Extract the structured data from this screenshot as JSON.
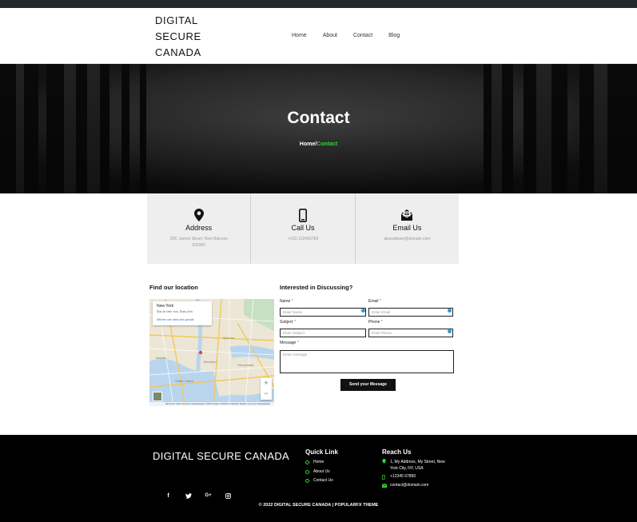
{
  "header": {
    "logo_line1": "DIGITAL",
    "logo_line2": "SECURE",
    "logo_line3": "CANADA",
    "nav": [
      "Home",
      "About",
      "Contact",
      "Blog"
    ]
  },
  "hero": {
    "title": "Contact",
    "breadcrumb_home": "Home/",
    "breadcrumb_current": "Contact"
  },
  "info": [
    {
      "title": "Address",
      "text": "208, James Street, New Balcony 502360",
      "icon": "map-pin-icon"
    },
    {
      "title": "Call Us",
      "text": "+(23) 123456789",
      "icon": "phone-icon"
    },
    {
      "title": "Email Us",
      "text": "abcpaiteam@domain.com",
      "icon": "envelope-icon"
    }
  ],
  "map": {
    "heading": "Find our location",
    "card_title": "New York",
    "card_sub": "État de New York, États-Unis",
    "card_link": "Afficher une carte plus grande",
    "zoom_in": "+",
    "zoom_out": "−",
    "footer": "Raccourcis clavier   Données cartographiques ©2022 Google   Conditions d'utilisation   Signaler une erreur cartographique"
  },
  "form": {
    "heading": "Interested in Discussing?",
    "name_label": "Name",
    "name_placeholder": "Enter Name",
    "email_label": "Email",
    "email_placeholder": "Enter Email",
    "subject_label": "Subject",
    "subject_placeholder": "Enter Subject",
    "phone_label": "Phone",
    "phone_placeholder": "Enter Phone",
    "message_label": "Message",
    "message_placeholder": "Enter message",
    "required_mark": "*",
    "submit": "Send your Message"
  },
  "footer": {
    "brand": "DIGITAL SECURE CANADA",
    "quick_title": "Quick Link",
    "quick_links": [
      "Home",
      "About Us",
      "Contact Us"
    ],
    "reach_title": "Reach Us",
    "address_line1": "1, My Address, My Street, New",
    "address_line2": "York City, NY, USA",
    "phone": "+12345 67890",
    "email": "contact@domain.com",
    "social": [
      "f",
      "t",
      "G+",
      "ig"
    ],
    "copyright": "© 2022 DIGITAL SECURE CANADA | POPULARFX THEME"
  },
  "colors": {
    "accent_green": "#2fd52f",
    "footer_bg": "#000000",
    "topbar": "#23282d"
  }
}
